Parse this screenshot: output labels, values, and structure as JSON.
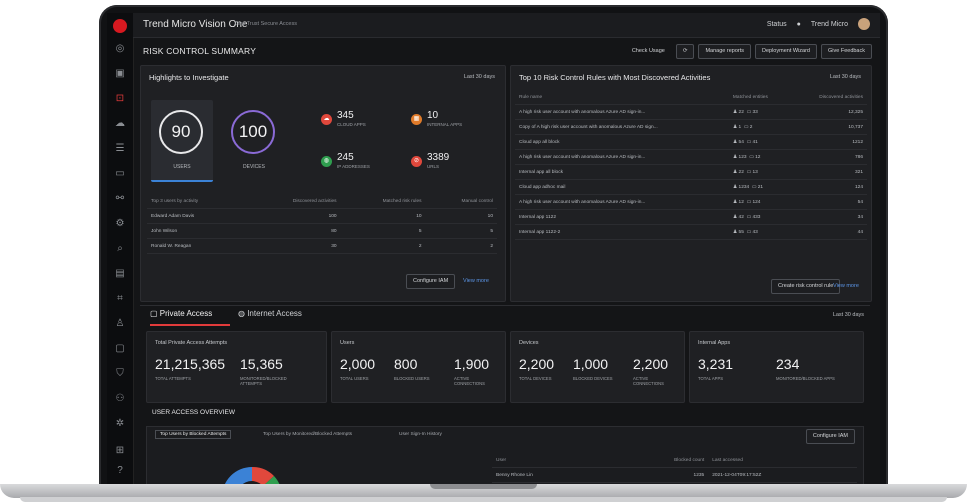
{
  "app": {
    "title": "Trend Micro Vision One",
    "subtitle": "Zero Trust Secure Access"
  },
  "topbar": {
    "status": "Status",
    "user": "Trend Micro"
  },
  "page": {
    "title": "RISK CONTROL SUMMARY"
  },
  "head_actions": {
    "check_usage": "Check Usage",
    "manage_reports": "Manage reports",
    "deployment_wizard": "Deployment Wizard",
    "give_feedback": "Give Feedback"
  },
  "highlights": {
    "title": "Highlights to Investigate",
    "period": "Last 30 days",
    "users_value": "90",
    "users_label": "USERS",
    "devices_value": "100",
    "devices_label": "DEVICES",
    "stats": [
      {
        "value": "345",
        "label": "CLOUD APPS",
        "color": "#e0483c"
      },
      {
        "value": "10",
        "label": "INTERNAL APPS",
        "color": "#e07b2a"
      },
      {
        "value": "245",
        "label": "IP ADDRESSES",
        "color": "#2f9e4f"
      },
      {
        "value": "3389",
        "label": "URLS",
        "color": "#e0483c"
      }
    ],
    "table_headers": [
      "Top 3 users by activity",
      "Discovered activities",
      "Matched risk rules",
      "Manual control"
    ],
    "rows": [
      [
        "Edward Adam Davis",
        "100",
        "10",
        "10"
      ],
      [
        "John Wilson",
        "80",
        "5",
        "5"
      ],
      [
        "Ronald W. Reagan",
        "30",
        "2",
        "2"
      ]
    ],
    "configure": "Configure IAM",
    "view_more": "View more"
  },
  "risk_rules": {
    "title": "Top 10 Risk Control Rules with Most Discovered Activities",
    "period": "Last 30 days",
    "headers": [
      "Rule name",
      "Matched entities",
      "Discovered activities"
    ],
    "rows": [
      {
        "name": "A high risk user account with anomalous Azure AD sign-in...",
        "users": "22",
        "devices": "33",
        "activities": "12,325"
      },
      {
        "name": "Copy of A high risk user account with anomalous Azure AD sign...",
        "users": "1",
        "devices": "2",
        "activities": "10,737"
      },
      {
        "name": "Cloud app all block",
        "users": "54",
        "devices": "41",
        "activities": "1212"
      },
      {
        "name": "A high risk user account with anomalous Azure AD sign-in...",
        "users": "123",
        "devices": "12",
        "activities": "786"
      },
      {
        "name": "Internal app all block",
        "users": "22",
        "devices": "13",
        "activities": "321"
      },
      {
        "name": "Cloud app adhoc mail",
        "users": "1234",
        "devices": "21",
        "activities": "124"
      },
      {
        "name": "A high risk user account with anomalous Azure AD sign-in...",
        "users": "12",
        "devices": "124",
        "activities": "54"
      },
      {
        "name": "Internal app 1122",
        "users": "42",
        "devices": "433",
        "activities": "34"
      },
      {
        "name": "Internal app 1122-2",
        "users": "55",
        "devices": "43",
        "activities": "44"
      }
    ],
    "create": "Create risk control rule",
    "view_more": "View more"
  },
  "access_tabs": {
    "private": "Private Access",
    "internet": "Internet Access",
    "period": "Last 30 days"
  },
  "kpis": [
    {
      "title": "Total Private Access Attempts",
      "items": [
        {
          "value": "21,215,365",
          "label": "TOTAL ATTEMPTS"
        },
        {
          "value": "15,365",
          "label": "MONITORED/BLOCKED ATTEMPTS"
        }
      ]
    },
    {
      "title": "Users",
      "items": [
        {
          "value": "2,000",
          "label": "TOTAL USERS"
        },
        {
          "value": "800",
          "label": "BLOCKED USERS"
        },
        {
          "value": "1,900",
          "label": "ACTIVE CONNECTIONS"
        }
      ]
    },
    {
      "title": "Devices",
      "items": [
        {
          "value": "2,200",
          "label": "TOTAL DEVICES"
        },
        {
          "value": "1,000",
          "label": "BLOCKED DEVICES"
        },
        {
          "value": "2,200",
          "label": "ACTIVE CONNECTIONS"
        }
      ]
    },
    {
      "title": "Internal Apps",
      "items": [
        {
          "value": "3,231",
          "label": "TOTAL APPS"
        },
        {
          "value": "234",
          "label": "MONITORED/BLOCKED APPS"
        }
      ]
    }
  ],
  "overview": {
    "title": "USER ACCESS OVERVIEW",
    "tabs": [
      "Top Users by Blocked Attempts",
      "Top Users by Monitored/Blocked Attempts",
      "User Sign-In History"
    ],
    "configure": "Configure IAM",
    "headers": [
      "User",
      "Blocked count",
      "Last accessed"
    ],
    "row": {
      "user": "Benny Rhone Lin",
      "count": "1235",
      "last": "2021-12-04T09:17:52Z"
    }
  }
}
